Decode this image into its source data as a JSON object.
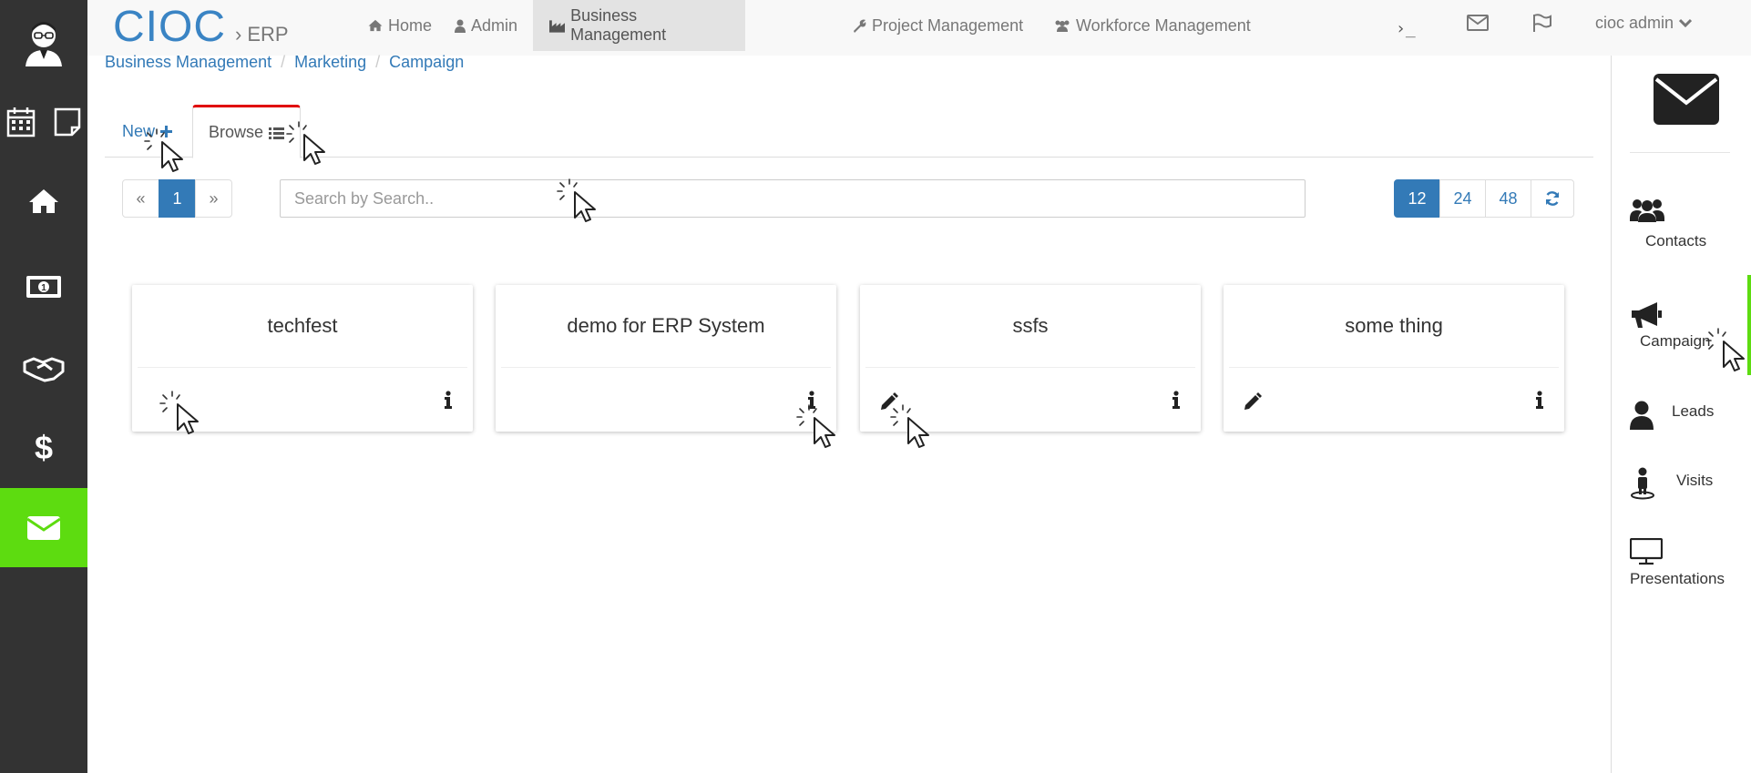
{
  "brand": {
    "name": "CIOC",
    "separator": "›",
    "sub": "ERP"
  },
  "nav": {
    "items": [
      {
        "label": "Home",
        "icon": "home-icon"
      },
      {
        "label": "Admin",
        "icon": "user-icon"
      },
      {
        "label": "Business Management",
        "icon": "industry-icon",
        "active": true
      },
      {
        "label": "Project Management",
        "icon": "wrench-icon"
      },
      {
        "label": "Workforce Management",
        "icon": "users-icon"
      }
    ],
    "terminal": "›_",
    "user": "cioc admin"
  },
  "breadcrumb": [
    "Business Management",
    "Marketing",
    "Campaign"
  ],
  "tabs": {
    "new": "New",
    "browse": "Browse"
  },
  "pager": {
    "prev": "«",
    "page": "1",
    "next": "»"
  },
  "search": {
    "placeholder": "Search by Search.."
  },
  "page_sizes": [
    "12",
    "24",
    "48"
  ],
  "cards": [
    {
      "title": "techfest"
    },
    {
      "title": "demo for ERP System"
    },
    {
      "title": "ssfs"
    },
    {
      "title": "some thing"
    }
  ],
  "right_panel": {
    "items": [
      {
        "label": "Contacts",
        "icon": "users-icon"
      },
      {
        "label": "Campaign",
        "icon": "bullhorn-icon",
        "active": true
      },
      {
        "label": "Leads",
        "icon": "user-icon"
      },
      {
        "label": "Visits",
        "icon": "street-view-icon"
      },
      {
        "label": "Presentations",
        "icon": "desktop-icon"
      }
    ]
  },
  "colors": {
    "brand": "#3a84c4",
    "sidebar": "#333333",
    "active_green": "#5ddc10",
    "link": "#337ab7",
    "tab_accent": "#e00000"
  }
}
